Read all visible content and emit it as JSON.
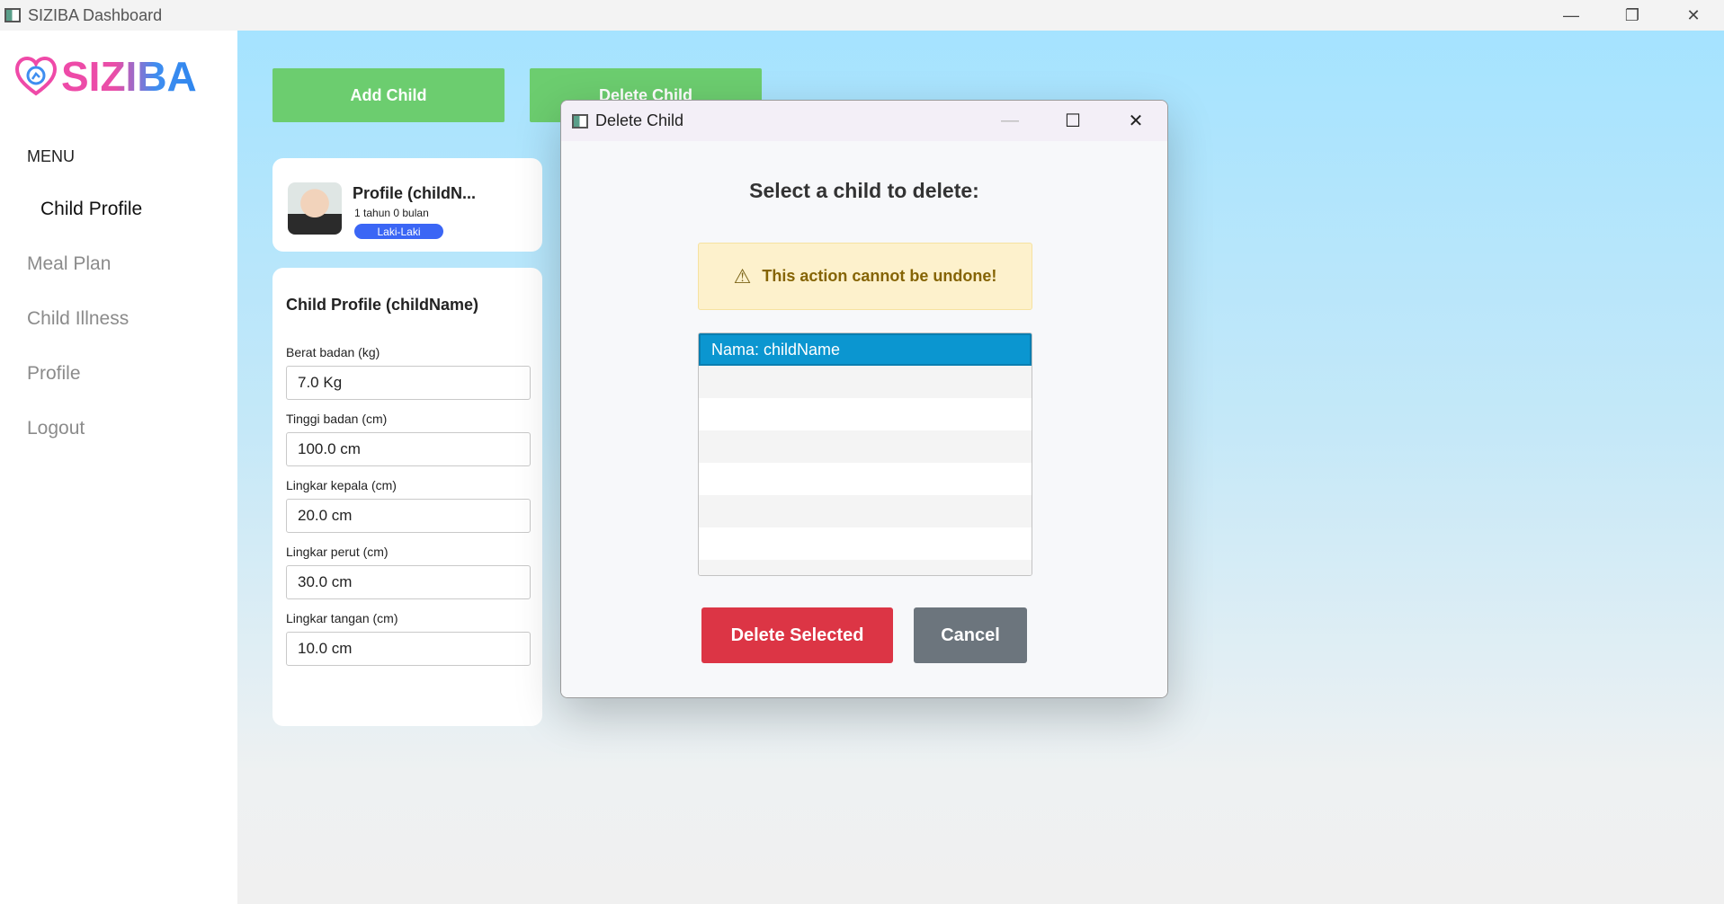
{
  "window": {
    "title": "SIZIBA Dashboard",
    "controls": {
      "minimize": "—",
      "restore": "❐",
      "close": "✕"
    }
  },
  "sidebar": {
    "brand": "SIZIBA",
    "menu_title": "MENU",
    "items": [
      {
        "label": "Child Profile",
        "active": true
      },
      {
        "label": "Meal Plan"
      },
      {
        "label": "Child Illness"
      },
      {
        "label": "Profile"
      },
      {
        "label": "Logout"
      }
    ]
  },
  "toolbar": {
    "add_child": "Add Child",
    "delete_child": "Delete Child"
  },
  "profile_card": {
    "name": "Profile (childN...",
    "age": "1 tahun 0 bulan",
    "gender": "Laki-Laki"
  },
  "detail_card": {
    "title": "Child Profile (childName)",
    "fields": [
      {
        "label": "Berat badan (kg)",
        "value": "7.0 Kg"
      },
      {
        "label": "Tinggi badan (cm)",
        "value": "100.0 cm"
      },
      {
        "label": "Lingkar kepala (cm)",
        "value": "20.0 cm"
      },
      {
        "label": "Lingkar perut (cm)",
        "value": "30.0 cm"
      },
      {
        "label": "Lingkar tangan (cm)",
        "value": "10.0 cm"
      }
    ]
  },
  "dialog": {
    "title": "Delete Child",
    "controls": {
      "minimize": "—",
      "maximize": "☐",
      "close": "✕"
    },
    "heading": "Select a child to delete:",
    "warning_icon": "⚠",
    "warning": "This action cannot be undone!",
    "list_items": [
      "Nama: childName"
    ],
    "delete_label": "Delete Selected",
    "cancel_label": "Cancel"
  },
  "colors": {
    "accent_green": "#6ccd6f",
    "danger": "#dc3545",
    "secondary": "#6c757d",
    "selection": "#0b96d0",
    "badge_blue": "#3b66f5",
    "warning_bg": "#fdf1cc"
  }
}
